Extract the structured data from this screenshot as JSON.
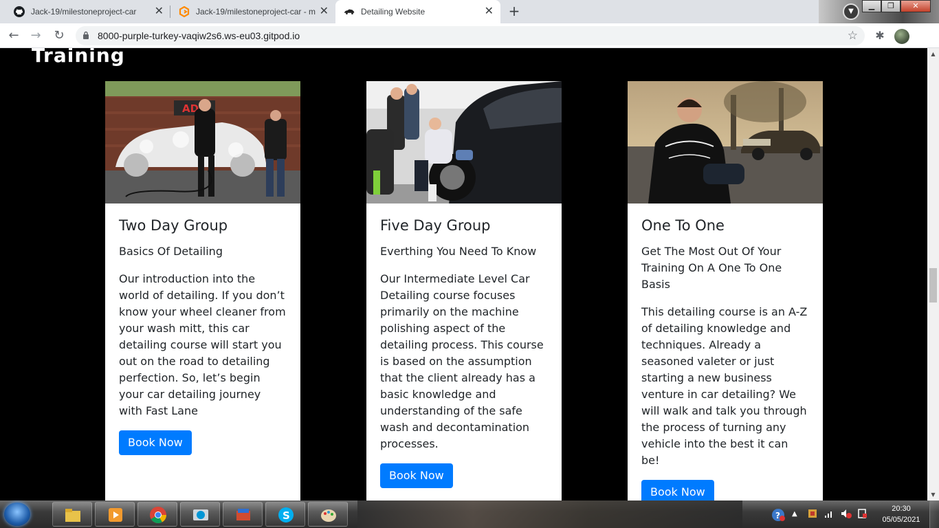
{
  "browser": {
    "tabs": [
      {
        "title": "Jack-19/milestoneproject-car",
        "icon": "github-icon"
      },
      {
        "title": "Jack-19/milestoneproject-car - m",
        "icon": "gitpod-icon"
      },
      {
        "title": "Detailing Website",
        "icon": "car-icon"
      }
    ],
    "new_tab_label": "+",
    "url": "8000-purple-turkey-vaqiw2s6.ws-eu03.gitpod.io",
    "window_controls": {
      "minimize": "▁",
      "maximize": "❐",
      "close": "✕"
    }
  },
  "page": {
    "heading": "Training",
    "cards": [
      {
        "title": "Two Day Group",
        "subtitle": "Basics Of Detailing",
        "text": "Our introduction into the world of detailing. If you don’t know your wheel cleaner from your wash mitt, this car detailing course will start you out on the road to detailing perfection. So, let’s begin your car detailing journey with Fast Lane",
        "button": "Book Now",
        "photo_sign": "ADP"
      },
      {
        "title": "Five Day Group",
        "subtitle": "Everthing You Need To Know",
        "text": "Our Intermediate Level Car Detailing course focuses primarily on the machine polishing aspect of the detailing process. This course is based on the assumption that the client already has a basic knowledge and understanding of the safe wash and decontamination processes.",
        "button": "Book Now"
      },
      {
        "title": "One To One",
        "subtitle": "Get The Most Out Of Your Training On A One To One Basis",
        "text": "This detailing course is an A-Z of detailing knowledge and techniques. Already a seasoned valeter or just starting a new business venture in car detailing? We will walk and talk you through the process of turning any vehicle into the best it can be!",
        "button": "Book Now"
      }
    ],
    "colors": {
      "background": "#000000",
      "card": "#ffffff",
      "button": "#007bff"
    }
  },
  "taskbar": {
    "apps": [
      "file-explorer-icon",
      "media-player-icon",
      "chrome-icon",
      "hp-icon",
      "paint-tool-icon",
      "skype-icon",
      "paint-palette-icon"
    ],
    "time": "20:30",
    "date": "05/05/2021"
  }
}
